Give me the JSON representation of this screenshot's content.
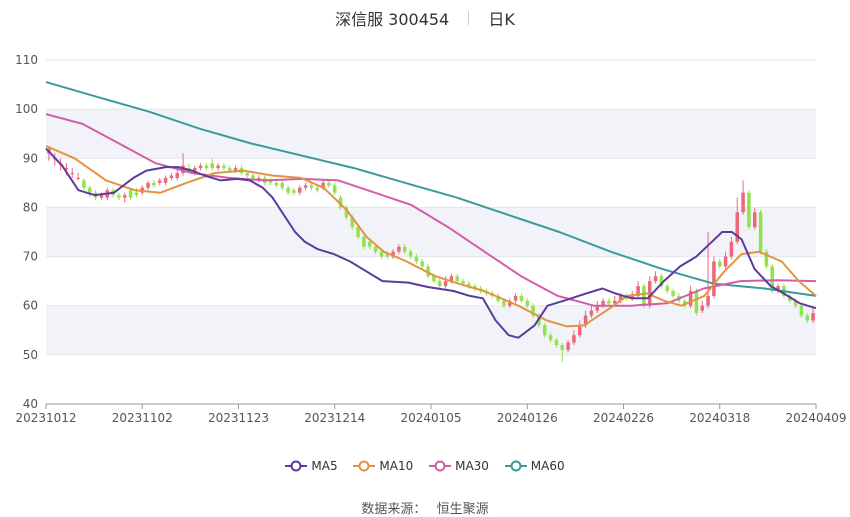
{
  "header": {
    "title": "深信服 300454",
    "period": "日K"
  },
  "source": {
    "label": "数据来源：",
    "value": "恒生聚源"
  },
  "colors": {
    "up": "#ee6677",
    "down": "#91e34e",
    "ma5": "#5b3b9e",
    "ma10": "#e39440",
    "ma30": "#d35ea8",
    "ma60": "#3a9a9c",
    "band": "#f2f3f8",
    "grid": "#e4e6ee"
  },
  "chart_data": {
    "type": "candlestick",
    "ylim": [
      40,
      110
    ],
    "yticks": [
      40,
      50,
      60,
      70,
      80,
      90,
      100,
      110
    ],
    "xticks": [
      "20231012",
      "20231102",
      "20231123",
      "20231214",
      "20240105",
      "20240126",
      "20240226",
      "20240318",
      "20240409"
    ],
    "grid": true,
    "legend_position": "bottom",
    "candles": [
      [
        91,
        92,
        89.5,
        92.5
      ],
      [
        90,
        90,
        88.5,
        91
      ],
      [
        89,
        89,
        87.5,
        90
      ],
      [
        88,
        88,
        86.5,
        89
      ],
      [
        87,
        87,
        86,
        88
      ],
      [
        86,
        86,
        85.5,
        87
      ],
      [
        85.5,
        84,
        83.5,
        86
      ],
      [
        84,
        83,
        82,
        84.5
      ],
      [
        83,
        82,
        81.5,
        83.5
      ],
      [
        82,
        82.5,
        81.5,
        83
      ],
      [
        82,
        83.5,
        81.5,
        84
      ],
      [
        83.5,
        82.5,
        82,
        84
      ],
      [
        82.5,
        82,
        81.5,
        83
      ],
      [
        82,
        82.5,
        81,
        83
      ],
      [
        83.5,
        82,
        81.5,
        84
      ],
      [
        83,
        82.5,
        82,
        84
      ],
      [
        83,
        84,
        82.5,
        84.5
      ],
      [
        84,
        85,
        83.5,
        85.5
      ],
      [
        85,
        84.5,
        84,
        85.5
      ],
      [
        85,
        85.5,
        84.5,
        86
      ],
      [
        85,
        86,
        84.5,
        86.5
      ],
      [
        86,
        86.5,
        85.5,
        87
      ],
      [
        86,
        87,
        85.5,
        88
      ],
      [
        87,
        88.5,
        86.5,
        91
      ],
      [
        88,
        87.5,
        87,
        89
      ],
      [
        87,
        88,
        86.5,
        88.5
      ],
      [
        88,
        88.5,
        87.5,
        89
      ],
      [
        88.5,
        88,
        87.5,
        89
      ],
      [
        89,
        88,
        87.5,
        90
      ],
      [
        88,
        88.5,
        87.5,
        89
      ],
      [
        88.5,
        88,
        87.5,
        89
      ],
      [
        88,
        87.5,
        87,
        88.5
      ],
      [
        87.5,
        88,
        87,
        88.5
      ],
      [
        88,
        87,
        86.5,
        88.5
      ],
      [
        87,
        86.5,
        86,
        87.5
      ],
      [
        86.5,
        85.5,
        85,
        87
      ],
      [
        85.5,
        86,
        85,
        86.5
      ],
      [
        86,
        85,
        84.5,
        86.5
      ],
      [
        85.5,
        85,
        84.5,
        86
      ],
      [
        85,
        84.5,
        84,
        85.5
      ],
      [
        85,
        84,
        83.5,
        85.5
      ],
      [
        84,
        83,
        82.5,
        84.5
      ],
      [
        83.5,
        83,
        82.5,
        84
      ],
      [
        83,
        84,
        82.5,
        84.5
      ],
      [
        84,
        84.5,
        83.5,
        85
      ],
      [
        84.5,
        84,
        83.5,
        85
      ],
      [
        84,
        83.5,
        83,
        84.5
      ],
      [
        84,
        85,
        83.5,
        85.5
      ],
      [
        85,
        84.5,
        84,
        85.5
      ],
      [
        84.5,
        83,
        82.5,
        85
      ],
      [
        82,
        80,
        79.5,
        82.5
      ],
      [
        80,
        78,
        77.5,
        80.5
      ],
      [
        78,
        76,
        75.5,
        78.5
      ],
      [
        76,
        74,
        73.5,
        76.5
      ],
      [
        74,
        72,
        71.5,
        74.5
      ],
      [
        73,
        72,
        71.5,
        73.5
      ],
      [
        72,
        71,
        70.5,
        72.5
      ],
      [
        71,
        70,
        69.5,
        71.5
      ],
      [
        70.5,
        70,
        69.5,
        71
      ],
      [
        70,
        71,
        69.5,
        71.5
      ],
      [
        71,
        72,
        70.5,
        72.5
      ],
      [
        72,
        71,
        70.5,
        72.5
      ],
      [
        71,
        70,
        69.5,
        71.5
      ],
      [
        70,
        69,
        68.5,
        70.5
      ],
      [
        69,
        68,
        67.5,
        69.5
      ],
      [
        68,
        66,
        65.5,
        68.5
      ],
      [
        66,
        65,
        64.5,
        66.5
      ],
      [
        65,
        64,
        63.5,
        65.5
      ],
      [
        64,
        65,
        63.5,
        66
      ],
      [
        65,
        66,
        64.5,
        66.5
      ],
      [
        66,
        65,
        64.5,
        66.5
      ],
      [
        65,
        64.5,
        64,
        65.5
      ],
      [
        64.5,
        64,
        63.5,
        65
      ],
      [
        64,
        63.5,
        63,
        64.5
      ],
      [
        63.5,
        63,
        62.5,
        64
      ],
      [
        63,
        62.5,
        62,
        63.5
      ],
      [
        62.5,
        62,
        61.5,
        63
      ],
      [
        62,
        61,
        60.5,
        62.5
      ],
      [
        61,
        60,
        59.5,
        61.5
      ],
      [
        60,
        61,
        59.5,
        61.5
      ],
      [
        61,
        62,
        60.5,
        62.5
      ],
      [
        62,
        61,
        60.5,
        62.5
      ],
      [
        61,
        60,
        59.5,
        61.5
      ],
      [
        60,
        58,
        57.5,
        60.5
      ],
      [
        58,
        56,
        55.5,
        58.5
      ],
      [
        56,
        54,
        53.5,
        56.5
      ],
      [
        54,
        53,
        52.5,
        54.5
      ],
      [
        53,
        52,
        51.5,
        53.5
      ],
      [
        52,
        51,
        48.5,
        52.5
      ],
      [
        51,
        52.5,
        50.5,
        53
      ],
      [
        52.5,
        54,
        52,
        55
      ],
      [
        54,
        56,
        53.5,
        57
      ],
      [
        56,
        58,
        55.5,
        59
      ],
      [
        58,
        59,
        57.5,
        60
      ],
      [
        59,
        60,
        58.5,
        61
      ],
      [
        60,
        61,
        59.5,
        61.5
      ],
      [
        61,
        60.5,
        60,
        61.5
      ],
      [
        60.5,
        61,
        60,
        62
      ],
      [
        61,
        62,
        60.5,
        62.5
      ],
      [
        62,
        61.5,
        61,
        62.5
      ],
      [
        61.5,
        62,
        61,
        63
      ],
      [
        62,
        64,
        61.5,
        65
      ],
      [
        64,
        60,
        59.5,
        64.5
      ],
      [
        60,
        65,
        59.5,
        66
      ],
      [
        65,
        66,
        64.5,
        67
      ],
      [
        66,
        64,
        63.5,
        66.5
      ],
      [
        64,
        63,
        62.5,
        64.5
      ],
      [
        63,
        62,
        61.5,
        63.5
      ],
      [
        62,
        61,
        60.5,
        62.5
      ],
      [
        61,
        60,
        59.5,
        61.5
      ],
      [
        60,
        63,
        59.5,
        64
      ],
      [
        63,
        58.5,
        58,
        63.5
      ],
      [
        59,
        60,
        58.5,
        61
      ],
      [
        60,
        62,
        59.5,
        75
      ],
      [
        62,
        69,
        61.5,
        70
      ],
      [
        69,
        68,
        67.5,
        69.5
      ],
      [
        68,
        70,
        67.5,
        71
      ],
      [
        70,
        73,
        69.5,
        74
      ],
      [
        73,
        79,
        72.5,
        82
      ],
      [
        79,
        83,
        78.5,
        85.5
      ],
      [
        83,
        76,
        75.5,
        83.5
      ],
      [
        76,
        79,
        75.5,
        80
      ],
      [
        79,
        71,
        70.5,
        79.5
      ],
      [
        71,
        68,
        67.5,
        71.5
      ],
      [
        68,
        63,
        62.5,
        68.5
      ],
      [
        63,
        64,
        62.5,
        64.5
      ],
      [
        64,
        62,
        61.5,
        64.5
      ],
      [
        62,
        61,
        60.5,
        62.5
      ],
      [
        61,
        60,
        59.5,
        61.5
      ],
      [
        60,
        58,
        57.5,
        60.5
      ],
      [
        58,
        57,
        56.5,
        58.5
      ],
      [
        57,
        58.5,
        56.5,
        59.5
      ]
    ],
    "series": [
      {
        "name": "MA5",
        "values": [
          [
            0,
            92
          ],
          [
            5,
            88.5
          ],
          [
            10,
            83.5
          ],
          [
            15,
            82.5
          ],
          [
            21,
            83
          ],
          [
            27,
            86
          ],
          [
            31,
            87.5
          ],
          [
            37,
            88.2
          ],
          [
            41,
            88.2
          ],
          [
            45,
            87.5
          ],
          [
            49,
            86.5
          ],
          [
            54,
            85.5
          ],
          [
            59,
            85.8
          ],
          [
            63,
            85.5
          ],
          [
            67,
            84
          ],
          [
            70,
            82
          ],
          [
            74,
            78
          ],
          [
            77,
            75
          ],
          [
            80,
            73
          ],
          [
            84,
            71.5
          ],
          [
            89,
            70.5
          ],
          [
            94,
            69
          ],
          [
            99,
            67
          ],
          [
            104,
            65
          ],
          [
            112,
            64.7
          ],
          [
            118,
            63.8
          ],
          [
            126,
            63
          ],
          [
            131,
            62
          ],
          [
            135,
            61.5
          ],
          [
            139,
            57
          ],
          [
            143,
            54
          ],
          [
            146,
            53.5
          ],
          [
            151,
            56
          ],
          [
            155,
            60
          ],
          [
            160,
            61
          ],
          [
            167,
            62.5
          ],
          [
            172,
            63.5
          ],
          [
            176,
            62.5
          ],
          [
            181,
            61.5
          ],
          [
            186,
            61.5
          ],
          [
            191,
            65
          ],
          [
            196,
            68
          ],
          [
            201,
            70
          ],
          [
            205,
            72.5
          ],
          [
            209,
            75
          ],
          [
            212,
            75
          ],
          [
            215,
            73.5
          ],
          [
            219,
            67.5
          ],
          [
            224,
            64
          ],
          [
            228,
            62.5
          ],
          [
            233,
            60.5
          ],
          [
            238,
            59.5
          ]
        ]
      },
      {
        "name": "MA10",
        "values": [
          [
            0,
            92.5
          ],
          [
            10,
            90
          ],
          [
            21,
            85.5
          ],
          [
            31,
            83.5
          ],
          [
            40,
            83
          ],
          [
            49,
            85
          ],
          [
            59,
            87
          ],
          [
            69,
            87.5
          ],
          [
            79,
            86.5
          ],
          [
            89,
            86
          ],
          [
            97,
            84
          ],
          [
            105,
            79.5
          ],
          [
            112,
            74
          ],
          [
            118,
            71
          ],
          [
            126,
            69
          ],
          [
            136,
            66
          ],
          [
            144,
            64.5
          ],
          [
            153,
            63
          ],
          [
            165,
            60
          ],
          [
            175,
            57
          ],
          [
            182,
            55.8
          ],
          [
            188,
            56
          ],
          [
            197,
            59.5
          ],
          [
            203,
            62
          ],
          [
            210,
            62.5
          ],
          [
            216,
            61
          ],
          [
            222,
            60
          ],
          [
            230,
            62
          ],
          [
            237,
            67
          ],
          [
            243,
            70.5
          ],
          [
            249,
            71
          ],
          [
            257,
            69
          ],
          [
            263,
            65
          ],
          [
            269,
            62
          ]
        ]
      },
      {
        "name": "MA30",
        "values": [
          [
            0,
            99
          ],
          [
            14,
            97
          ],
          [
            28,
            93
          ],
          [
            42,
            89
          ],
          [
            56,
            87
          ],
          [
            70,
            86
          ],
          [
            84,
            85.5
          ],
          [
            98,
            85.8
          ],
          [
            112,
            85.5
          ],
          [
            126,
            83
          ],
          [
            140,
            80.5
          ],
          [
            154,
            76
          ],
          [
            168,
            71
          ],
          [
            182,
            66
          ],
          [
            196,
            62
          ],
          [
            210,
            60
          ],
          [
            224,
            60
          ],
          [
            238,
            60.5
          ],
          [
            252,
            63.5
          ],
          [
            266,
            65
          ],
          [
            280,
            65.2
          ],
          [
            295,
            65
          ]
        ]
      },
      {
        "name": "MA60",
        "values": [
          [
            0,
            105.5
          ],
          [
            20,
            102.5
          ],
          [
            40,
            99.5
          ],
          [
            60,
            96
          ],
          [
            80,
            93
          ],
          [
            100,
            90.5
          ],
          [
            120,
            88
          ],
          [
            140,
            85
          ],
          [
            160,
            82
          ],
          [
            180,
            78.5
          ],
          [
            200,
            75
          ],
          [
            220,
            71
          ],
          [
            240,
            67.5
          ],
          [
            260,
            64.5
          ],
          [
            280,
            63.5
          ],
          [
            300,
            62
          ]
        ]
      }
    ]
  },
  "legend": [
    "MA5",
    "MA10",
    "MA30",
    "MA60"
  ]
}
